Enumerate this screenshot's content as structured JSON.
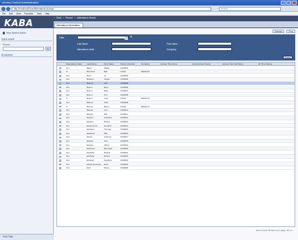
{
  "window": {
    "title": "Access Control Administration"
  },
  "browser": {
    "url": "http://localhost/Exos/AttendanceList.aspx",
    "search_placeholder": "Search"
  },
  "menubar": [
    "File",
    "Edit",
    "View",
    "Favorites",
    "Tools",
    "Help"
  ],
  "app": {
    "logo": "KABA",
    "breadcrumbs": [
      "Start",
      "Person",
      "Attendance Board"
    ]
  },
  "tabs": [
    "Attendance information"
  ],
  "toolbar": {
    "refresh": "Refresh",
    "print": "Print"
  },
  "sidebar": {
    "user": "Help System Admin",
    "quick_search_title": "Quick search",
    "person_label": "Person",
    "go_label": "Go",
    "bookmarks_title": "Bookmarks",
    "bottom_title": "Help Page"
  },
  "filter": {
    "title": "Filter",
    "add_glyph": "+",
    "last_name_label": "Last Name",
    "first_name_label": "First Name",
    "attendance_state_label": "Attendance state",
    "company_label": "Company",
    "search_button": "Search"
  },
  "grid": {
    "columns": [
      "",
      "Attendance State",
      "Last Name",
      "First Name",
      "Person Number",
      "Company",
      "Access Time Zone",
      "Access Event Name",
      "Access Terminal Name",
      "All Time Stamp"
    ],
    "rows": [
      [
        "Out",
        "Baker",
        "Walter",
        "1000001",
        "",
        "",
        "",
        "",
        ""
      ],
      [
        "In",
        "Bernstein",
        "Bob",
        "12341",
        "DEFAULT",
        "",
        "",
        "",
        ""
      ],
      [
        "Out",
        "Bohn",
        "Jo",
        "1000003",
        "",
        "",
        "",
        "",
        ""
      ],
      [
        "Out",
        "Bowden",
        "Jürgen",
        "1000004",
        "",
        "",
        "",
        "",
        ""
      ],
      [
        "Out",
        "Burrow",
        "Jeff",
        "1000005",
        "",
        "",
        "",
        "",
        ""
      ],
      [
        "Out",
        "Burton",
        "Berni",
        "1000006",
        "",
        "",
        "",
        "",
        ""
      ],
      [
        "Out",
        "Burton",
        "Mike",
        "1000007",
        "",
        "",
        "",
        "",
        ""
      ],
      [
        "Out",
        "Burton",
        "Tom",
        "1000008",
        "",
        "",
        "",
        "",
        ""
      ],
      [
        "In",
        "Burton",
        "Anne",
        "12342",
        "DEFAULT",
        "",
        "",
        "",
        ""
      ],
      [
        "Out",
        "Barrow",
        "John",
        "1000009",
        "",
        "",
        "",
        "",
        ""
      ],
      [
        "In",
        "Burrow",
        "Bernd",
        "12343",
        "DEFAULT",
        "",
        "",
        "",
        ""
      ],
      [
        "Out",
        "Bauder",
        "Cori",
        "1000010",
        "",
        "",
        "",
        "",
        ""
      ],
      [
        "Out",
        "Bauder",
        "Rita",
        "1000011",
        "",
        "",
        "",
        "",
        ""
      ],
      [
        "Out",
        "Eckertz",
        "Christina",
        "1000012",
        "",
        "",
        "",
        "",
        ""
      ],
      [
        "Out",
        "Eckerth",
        "Robert",
        "1000013",
        "",
        "",
        "",
        "",
        ""
      ],
      [
        "Out",
        "Eckelmanns",
        "Gerhard",
        "1000014",
        "",
        "",
        "",
        "",
        ""
      ],
      [
        "Out",
        "Eckstein",
        "Thomas",
        "1000015",
        "",
        "",
        "",
        "",
        ""
      ],
      [
        "Out",
        "Eckhardt",
        "Max",
        "1000016",
        "",
        "",
        "",
        "",
        ""
      ],
      [
        "Out",
        "Eckert",
        "Andreas",
        "1000017",
        "",
        "",
        "",
        "",
        ""
      ],
      [
        "Out",
        "Eckerle",
        "Jörn",
        "1000018",
        "",
        "",
        "",
        "",
        ""
      ],
      [
        "Out",
        "Eckerle",
        "Alfred",
        "1000019",
        "",
        "",
        "",
        "",
        ""
      ],
      [
        "Out",
        "Eckmann",
        "Bernhard",
        "1000020",
        "",
        "",
        "",
        "",
        ""
      ],
      [
        "Out",
        "Eckhöfer",
        "Roland",
        "1000021",
        "",
        "",
        "",
        "",
        ""
      ],
      [
        "Out",
        "Eckhöfer",
        "Robert",
        "1000022",
        "",
        "",
        "",
        "",
        ""
      ],
      [
        "Out",
        "Eckstein",
        "Siegfried",
        "1000023",
        "",
        "",
        "",
        "",
        ""
      ],
      [
        "Out",
        "Eckert-Hermann",
        "Erich",
        "1000024",
        "",
        "",
        "",
        "",
        ""
      ],
      [
        "Out",
        "Eckl",
        "Maria",
        "1000025",
        "",
        "",
        "",
        "",
        ""
      ]
    ],
    "selected_row": 4
  },
  "pager": {
    "info": "Items found: 50    Items per page: 25    1 2"
  },
  "colors": {
    "header": "#3a4d6e",
    "filter": "#3a5a8c",
    "selected": "#b8cde8"
  }
}
